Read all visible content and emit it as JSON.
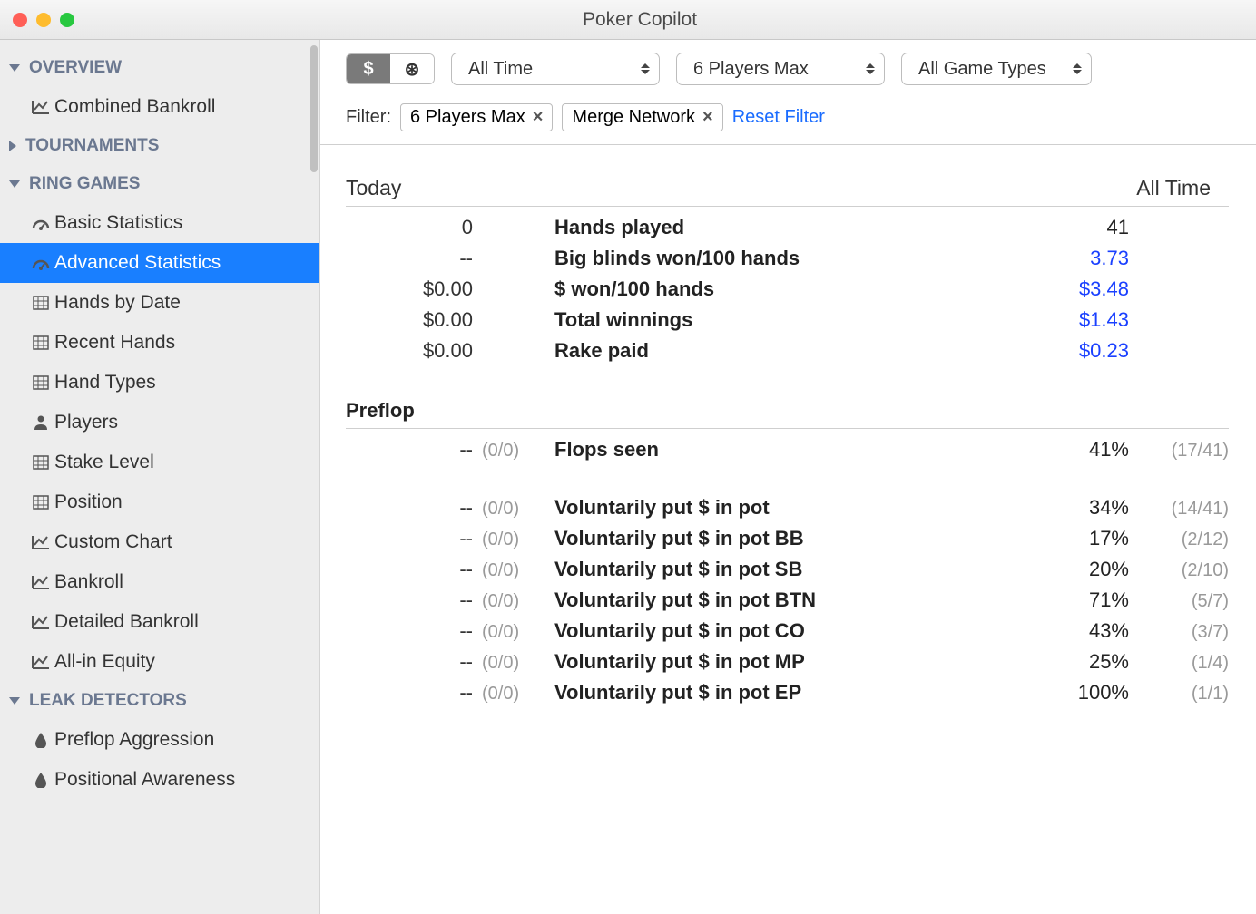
{
  "window": {
    "title": "Poker Copilot"
  },
  "sidebar": {
    "sections": [
      {
        "label": "OVERVIEW",
        "open": true,
        "items": [
          {
            "label": "Combined Bankroll",
            "icon": "chart"
          }
        ]
      },
      {
        "label": "TOURNAMENTS",
        "open": false,
        "items": []
      },
      {
        "label": "RING GAMES",
        "open": true,
        "items": [
          {
            "label": "Basic Statistics",
            "icon": "gauge"
          },
          {
            "label": "Advanced Statistics",
            "icon": "gauge",
            "selected": true
          },
          {
            "label": "Hands by Date",
            "icon": "grid"
          },
          {
            "label": "Recent Hands",
            "icon": "grid"
          },
          {
            "label": "Hand Types",
            "icon": "grid"
          },
          {
            "label": "Players",
            "icon": "person"
          },
          {
            "label": "Stake Level",
            "icon": "grid"
          },
          {
            "label": "Position",
            "icon": "grid"
          },
          {
            "label": "Custom Chart",
            "icon": "chart"
          },
          {
            "label": "Bankroll",
            "icon": "chart"
          },
          {
            "label": "Detailed Bankroll",
            "icon": "chart"
          },
          {
            "label": "All-in Equity",
            "icon": "chart"
          }
        ]
      },
      {
        "label": "LEAK DETECTORS",
        "open": true,
        "items": [
          {
            "label": "Preflop Aggression",
            "icon": "drop"
          },
          {
            "label": "Positional Awareness",
            "icon": "drop"
          }
        ]
      }
    ]
  },
  "toolbar": {
    "currency_toggle": {
      "on": "$",
      "off": "⊛"
    },
    "dropdowns": [
      {
        "value": "All Time"
      },
      {
        "value": "6 Players Max"
      },
      {
        "value": "All Game Types"
      }
    ]
  },
  "filter": {
    "label": "Filter:",
    "chips": [
      {
        "text": "6 Players Max"
      },
      {
        "text": "Merge Network"
      }
    ],
    "reset": "Reset Filter"
  },
  "stats": {
    "head_today": "Today",
    "head_alltime": "All Time",
    "summary": [
      {
        "today": "0",
        "label": "Hands played",
        "val": "41",
        "blue": false
      },
      {
        "today": "--",
        "label": "Big blinds won/100 hands",
        "val": "3.73",
        "blue": true
      },
      {
        "today": "$0.00",
        "label": "$ won/100 hands",
        "val": "$3.48",
        "blue": true
      },
      {
        "today": "$0.00",
        "label": "Total winnings",
        "val": "$1.43",
        "blue": true
      },
      {
        "today": "$0.00",
        "label": "Rake paid",
        "val": "$0.23",
        "blue": true
      }
    ],
    "preflop_title": "Preflop",
    "preflop1": [
      {
        "today": "--",
        "tfrac": "(0/0)",
        "label": "Flops seen",
        "val": "41%",
        "frac": "(17/41)"
      }
    ],
    "preflop2": [
      {
        "today": "--",
        "tfrac": "(0/0)",
        "label": "Voluntarily put $ in pot",
        "val": "34%",
        "frac": "(14/41)"
      },
      {
        "today": "--",
        "tfrac": "(0/0)",
        "label": "Voluntarily put $ in pot BB",
        "val": "17%",
        "frac": "(2/12)"
      },
      {
        "today": "--",
        "tfrac": "(0/0)",
        "label": "Voluntarily put $ in pot SB",
        "val": "20%",
        "frac": "(2/10)"
      },
      {
        "today": "--",
        "tfrac": "(0/0)",
        "label": "Voluntarily put $ in pot BTN",
        "val": "71%",
        "frac": "(5/7)"
      },
      {
        "today": "--",
        "tfrac": "(0/0)",
        "label": "Voluntarily put $ in pot CO",
        "val": "43%",
        "frac": "(3/7)"
      },
      {
        "today": "--",
        "tfrac": "(0/0)",
        "label": "Voluntarily put $ in pot MP",
        "val": "25%",
        "frac": "(1/4)"
      },
      {
        "today": "--",
        "tfrac": "(0/0)",
        "label": "Voluntarily put $ in pot EP",
        "val": "100%",
        "frac": "(1/1)"
      }
    ]
  }
}
